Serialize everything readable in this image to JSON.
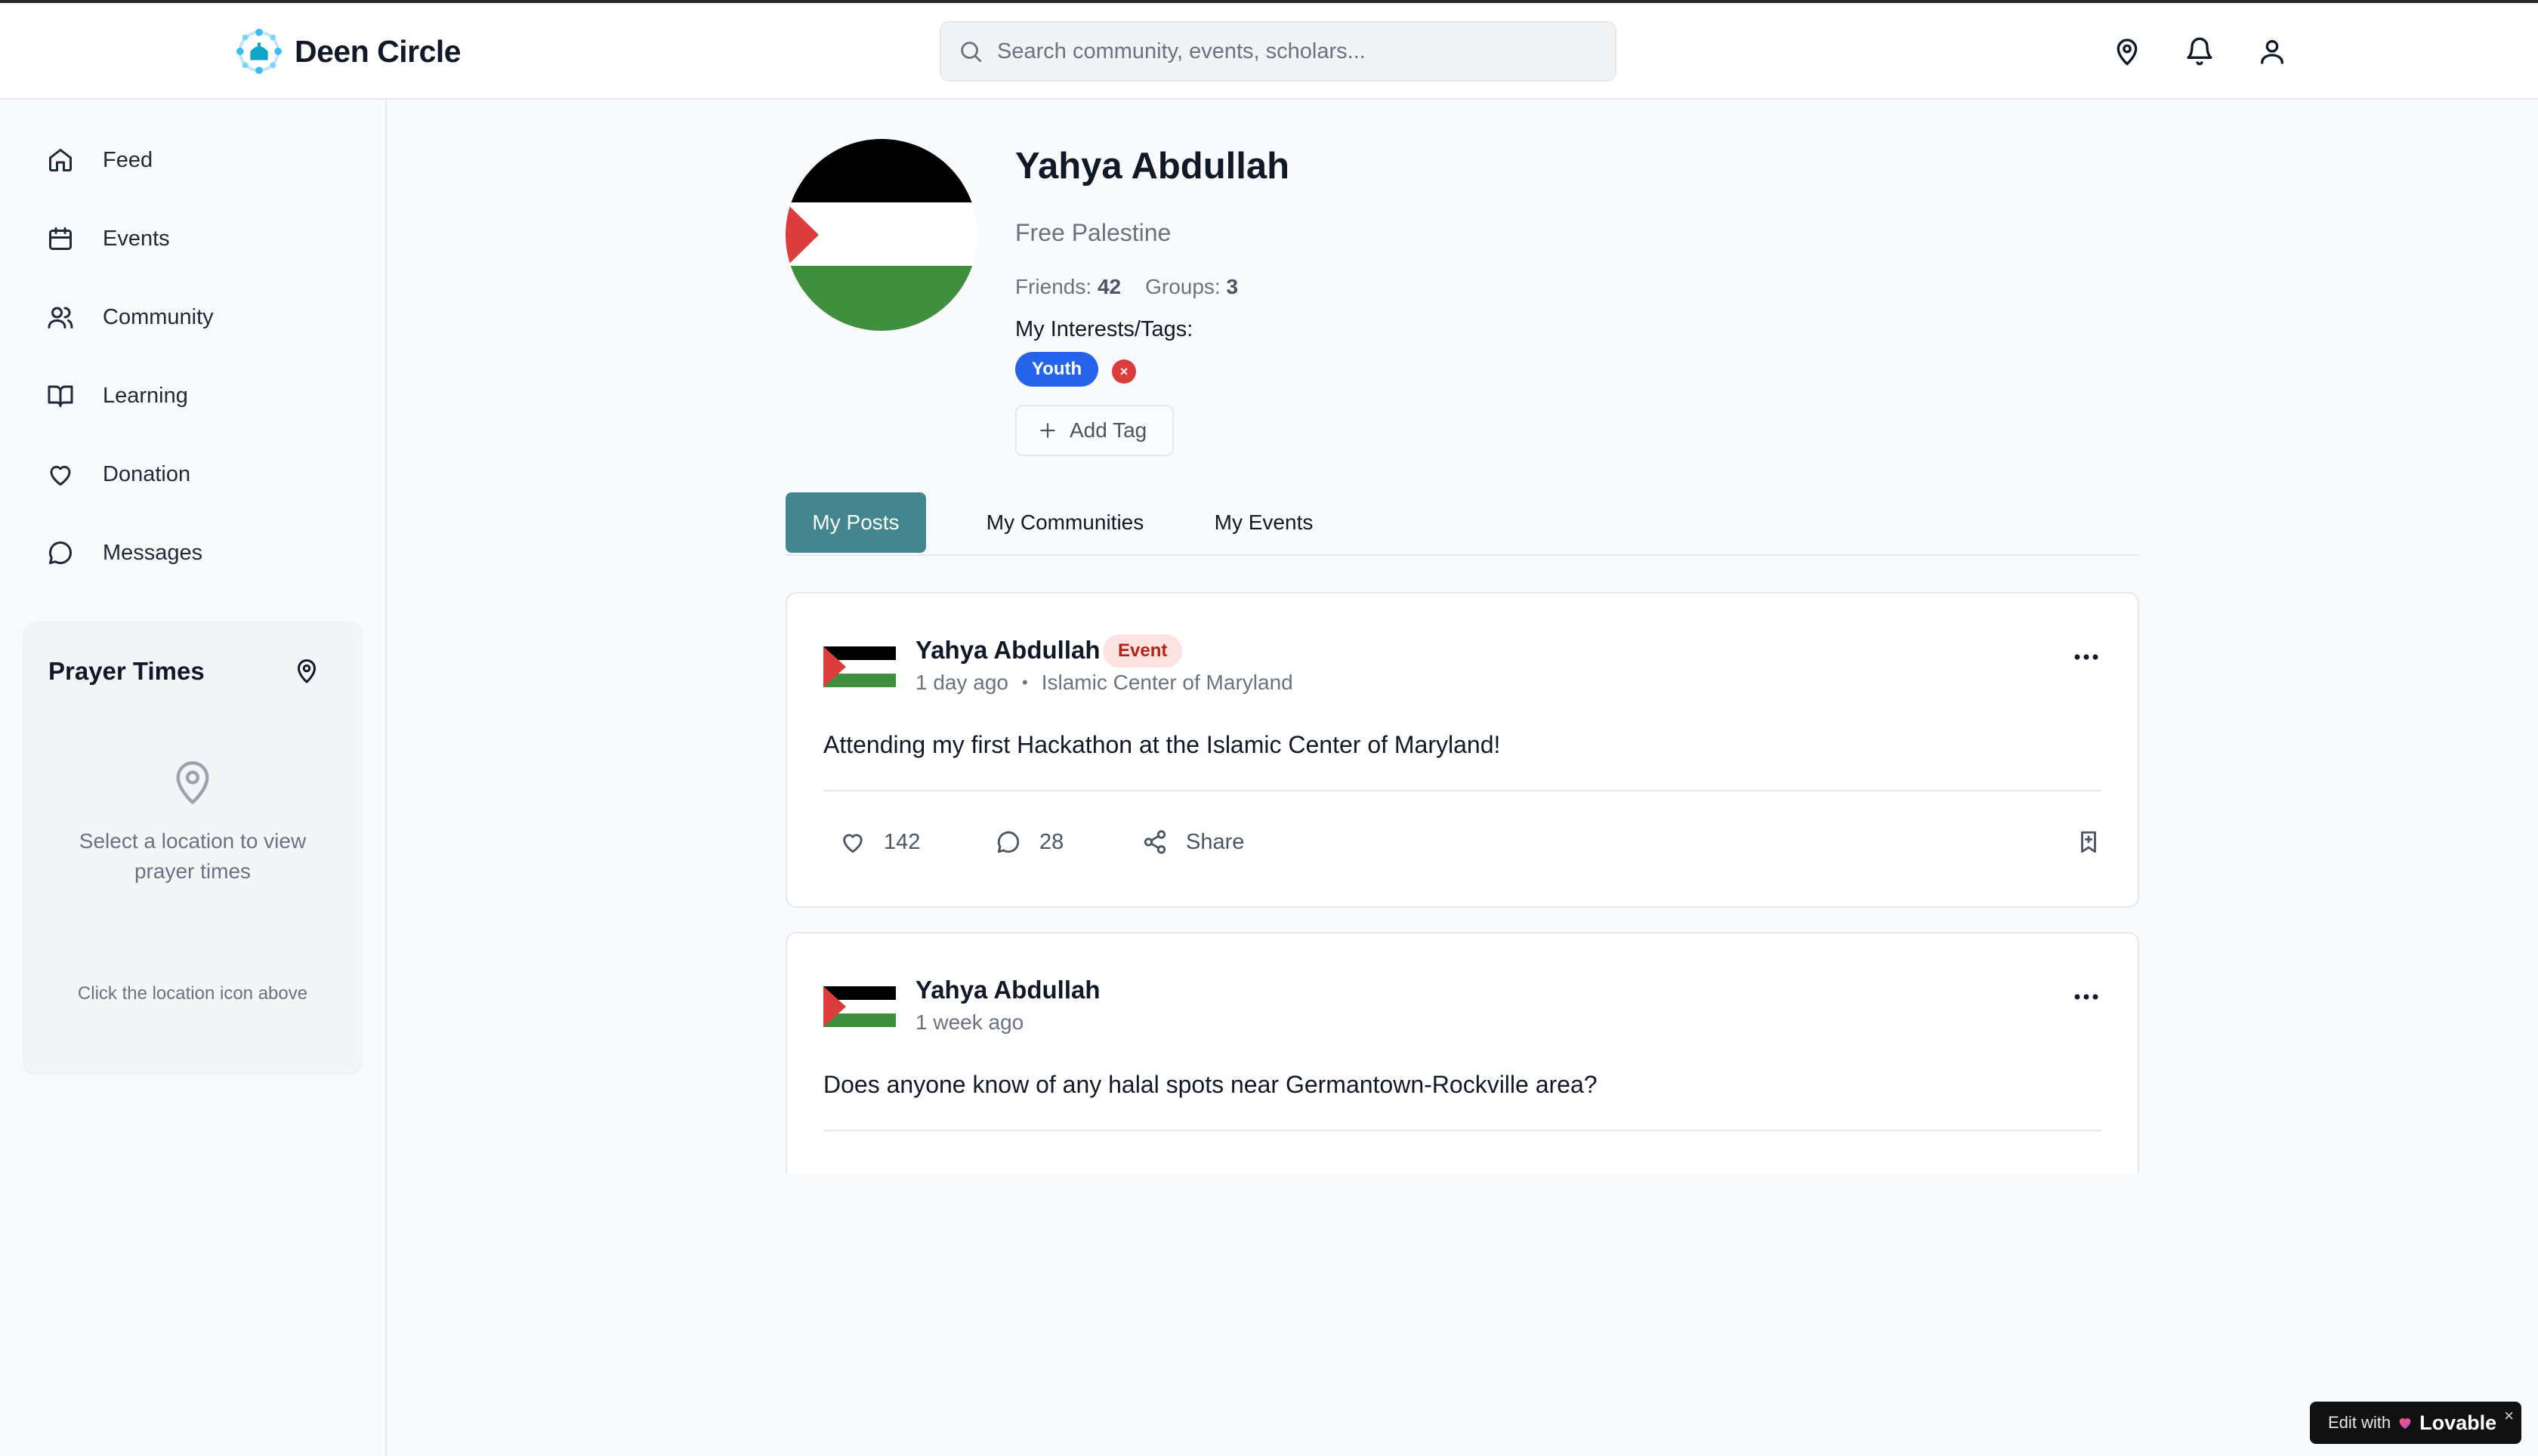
{
  "app": {
    "brand_name": "Deen Circle",
    "accent_color": "#44868f",
    "tag_color": "#2563eb"
  },
  "header": {
    "search_placeholder": "Search community, events, scholars...",
    "icons": [
      "location-pin-icon",
      "bell-icon",
      "user-icon"
    ]
  },
  "sidebar": {
    "items": [
      {
        "label": "Feed",
        "icon": "home-icon"
      },
      {
        "label": "Events",
        "icon": "calendar-icon"
      },
      {
        "label": "Community",
        "icon": "users-icon"
      },
      {
        "label": "Learning",
        "icon": "book-icon"
      },
      {
        "label": "Donation",
        "icon": "heart-icon"
      },
      {
        "label": "Messages",
        "icon": "message-icon"
      }
    ],
    "prayer": {
      "title": "Prayer Times",
      "message": "Select a location to view prayer times",
      "hint": "Click the location icon above"
    }
  },
  "profile": {
    "name": "Yahya Abdullah",
    "bio": "Free Palestine",
    "friends_label": "Friends:",
    "friends": "42",
    "groups_label": "Groups:",
    "groups": "3",
    "interests_label": "My Interests/Tags:",
    "tags": [
      "Youth"
    ],
    "tag_remove": "×",
    "add_tag_label": "Add Tag"
  },
  "tabs": [
    {
      "label": "My Posts",
      "active": true
    },
    {
      "label": "My Communities",
      "active": false
    },
    {
      "label": "My Events",
      "active": false
    }
  ],
  "posts": [
    {
      "author": "Yahya Abdullah",
      "badge": "Event",
      "time": "1 day ago",
      "separator": "•",
      "location": "Islamic Center of Maryland",
      "body": "Attending my first Hackathon at the Islamic Center of Maryland!",
      "likes": "142",
      "comments": "28",
      "share_label": "Share"
    },
    {
      "author": "Yahya Abdullah",
      "time": "1 week ago",
      "body": "Does anyone know of any halal spots near Germantown-Rockville area?"
    }
  ],
  "footer_badge": {
    "edit_label": "Edit with",
    "brand": "Lovable",
    "close": "×"
  }
}
